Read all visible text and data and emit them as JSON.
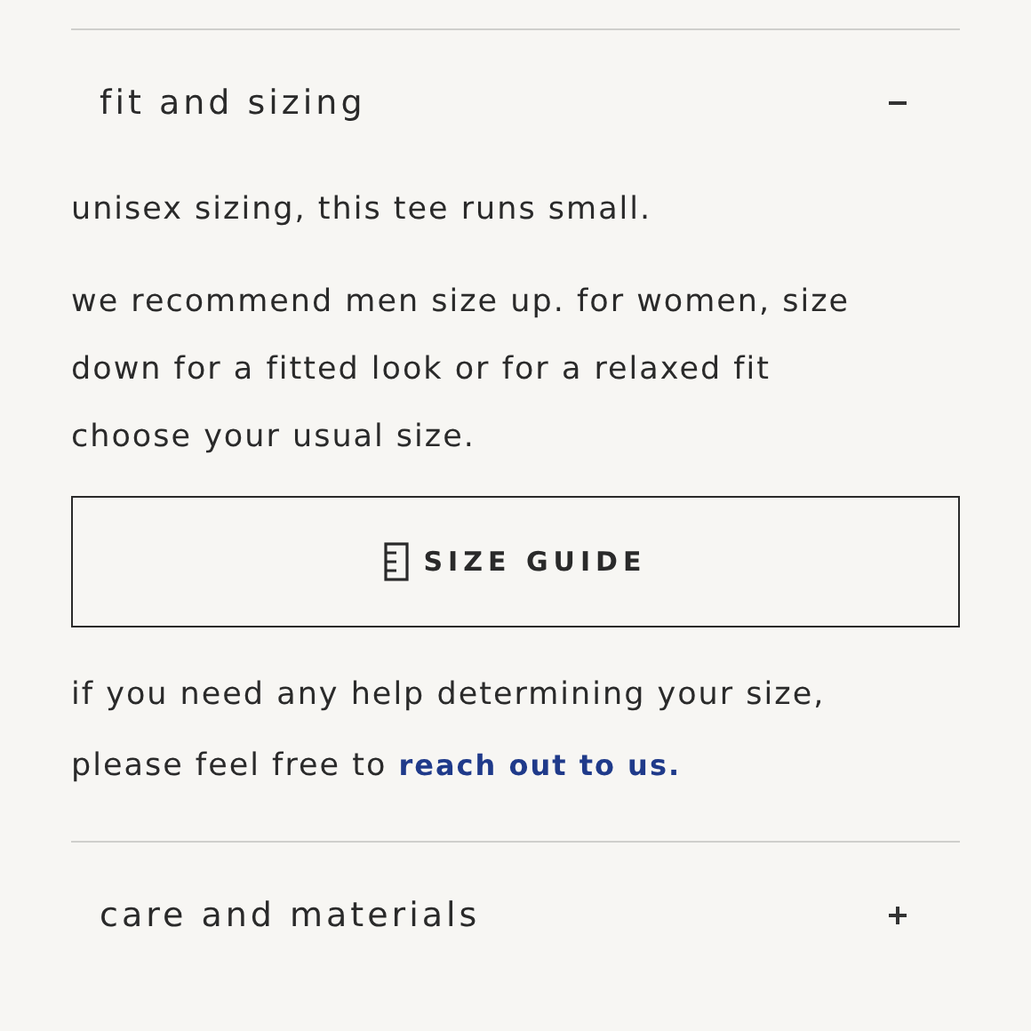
{
  "sections": [
    {
      "title": "fit and sizing",
      "expanded": true,
      "paragraphs": [
        "unisex sizing, this tee runs small.",
        "we recommend men size up. for women, size down for a fitted look or for a relaxed fit choose your usual size."
      ],
      "button": {
        "label": "SIZE GUIDE"
      },
      "help": {
        "text": "if you need any help determining your size, please feel free to",
        "link": "reach out to us."
      }
    },
    {
      "title": "care and materials",
      "expanded": false
    }
  ]
}
